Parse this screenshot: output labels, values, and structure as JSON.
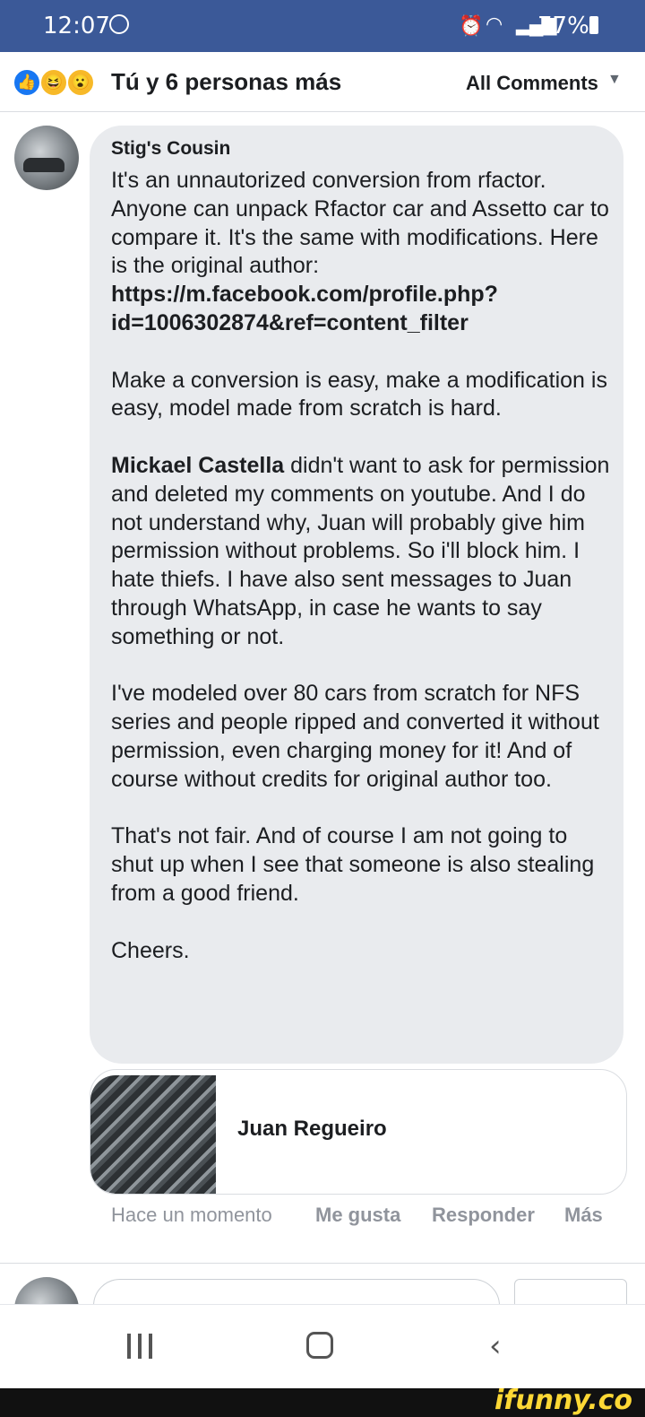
{
  "status_bar": {
    "time": "12:07",
    "battery": "77%"
  },
  "header": {
    "reactions": [
      "like-icon",
      "haha-icon",
      "wow-icon"
    ],
    "title": "Tú y 6 personas más",
    "filter": "All Comments"
  },
  "comment": {
    "author": "Stig's Cousin",
    "p1_text": "It's an unnautorized conversion from rfactor. Anyone can unpack Rfactor car and Assetto car to compare it. It's the same with modifications. Here is the original author: ",
    "p1_link": "https://m.facebook.com/profile.php?id=1006302874&ref=content_filter",
    "p2": "Make a conversion is easy, make a modification is easy, model made from scratch is hard.",
    "p3_mention": "Mickael Castella",
    "p3_text": " didn't want to ask for permission and deleted my comments on youtube. And I do not understand why, Juan will probably give him permission without problems. So i'll block him. I hate thiefs. I have also sent messages to Juan through WhatsApp, in case he wants to say something or not.",
    "p4": "I've modeled over 80 cars from scratch for NFS series and people ripped and converted it without permission, even charging money for it! And of course without credits for original author too.",
    "p5": "That's not fair. And of course I am not going to shut up when I see that someone is also stealing from a good friend.",
    "p6": "Cheers."
  },
  "linked_profile": {
    "name": "Juan Regueiro"
  },
  "actions": {
    "time": "Hace un momento",
    "like": "Me gusta",
    "reply": "Responder",
    "more": "Más"
  },
  "footer": {
    "watermark": "ifunny.co"
  },
  "colors": {
    "status_bar": "#3b5998",
    "bubble": "#e9ebee",
    "like_blue": "#1877f2",
    "muted": "#90949c"
  }
}
